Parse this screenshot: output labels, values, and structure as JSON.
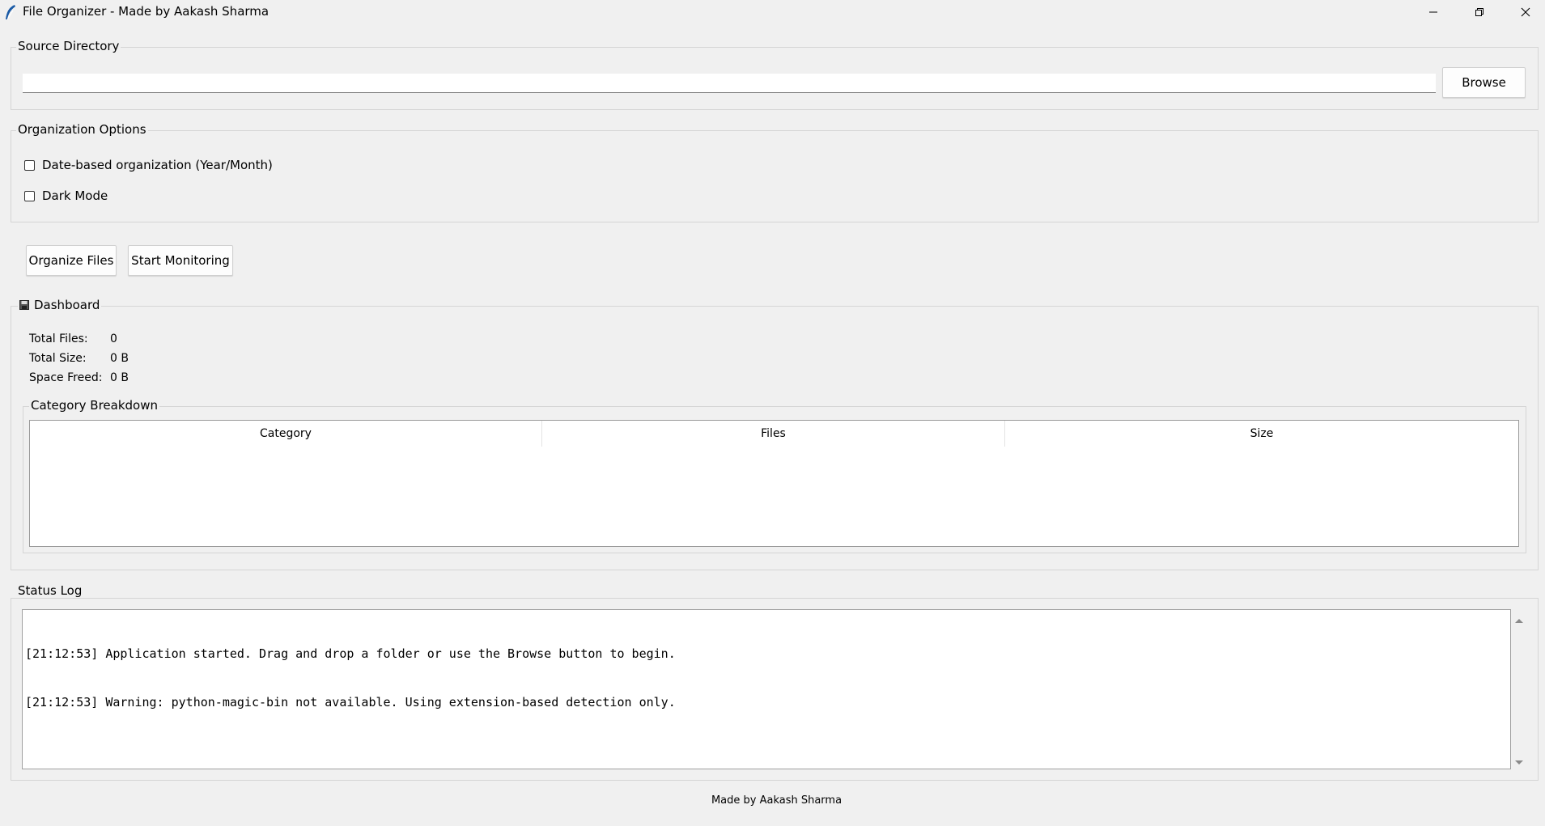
{
  "window": {
    "title": "File Organizer - Made by Aakash Sharma",
    "icons": {
      "app": "feather-icon",
      "minimize": "minimize-icon",
      "maximize": "restore-icon",
      "close": "close-icon"
    }
  },
  "source": {
    "title": "Source Directory",
    "path_value": "",
    "browse_label": "Browse"
  },
  "options": {
    "title": "Organization Options",
    "date_based": {
      "label": "Date-based organization (Year/Month)",
      "checked": false
    },
    "dark_mode": {
      "label": "Dark Mode",
      "checked": false
    }
  },
  "actions": {
    "organize_label": "Organize Files",
    "monitor_label": "Start Monitoring"
  },
  "dashboard": {
    "title": "Dashboard",
    "icon": "floppy-disk-icon",
    "stats": [
      {
        "label": "Total Files:",
        "value": "0"
      },
      {
        "label": "Total Size:",
        "value": "0 B"
      },
      {
        "label": "Space Freed:",
        "value": "0 B"
      }
    ],
    "breakdown": {
      "title": "Category Breakdown",
      "columns": [
        "Category",
        "Files",
        "Size"
      ],
      "rows": []
    }
  },
  "log": {
    "title": "Status Log",
    "lines": [
      "[21:12:53] Application started. Drag and drop a folder or use the Browse button to begin.",
      "[21:12:53] Warning: python-magic-bin not available. Using extension-based detection only."
    ]
  },
  "footer": {
    "text": "Made by Aakash Sharma"
  }
}
